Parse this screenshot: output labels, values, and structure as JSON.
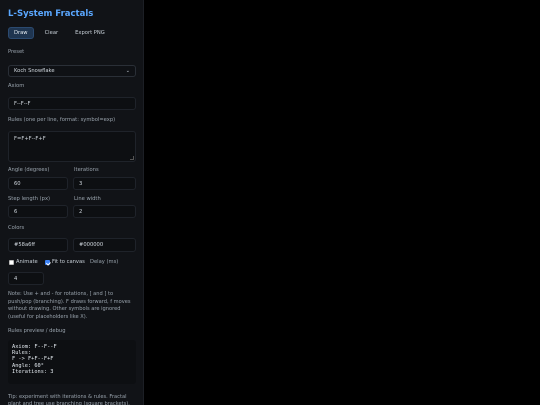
{
  "app": {
    "title": "L-System Fractals"
  },
  "toolbar": {
    "draw_label": "Draw",
    "clear_label": "Clear",
    "export_label": "Export PNG"
  },
  "preset": {
    "label": "Preset",
    "value": "Koch Snowflake"
  },
  "axiom": {
    "label": "Axiom",
    "value": "F--F--F"
  },
  "rules": {
    "label": "Rules (one per line, format: symbol=exp)",
    "value": "F=F+F--F+F"
  },
  "angle": {
    "label": "Angle (degrees)",
    "value": "60"
  },
  "iterations": {
    "label": "Iterations",
    "value": "3"
  },
  "step_length": {
    "label": "Step length (px)",
    "value": "6"
  },
  "line_width": {
    "label": "Line width",
    "value": "2"
  },
  "colors": {
    "label": "Colors",
    "stroke": "#58a6ff",
    "background": "#000000"
  },
  "options": {
    "animate_label": "Animate",
    "animate_checked": false,
    "fit_label": "Fit to canvas",
    "fit_checked": true,
    "delay_label": "Delay (ms)",
    "delay_value": "4"
  },
  "note": {
    "text": "Note: Use + and - for rotations, [ and ] to push/pop (branching). F draws forward, f moves without drawing. Other symbols are ignored (useful for placeholders like X)."
  },
  "debug": {
    "label": "Rules preview / debug",
    "text": "Axiom: F--F--F\nRules:\nF -> F+F--F+F\nAngle: 60°\nIterations: 3"
  },
  "tip": {
    "text": "Tip: experiment with iterations & rules. Fractal plant and tree use branching (square brackets)."
  }
}
